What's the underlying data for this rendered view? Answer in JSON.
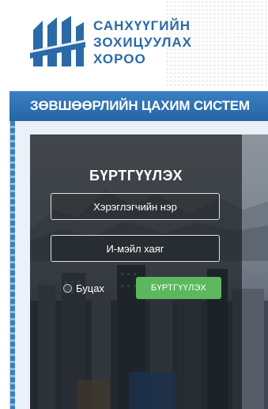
{
  "header": {
    "org_line1": "САНХҮҮГИЙН",
    "org_line2": "ЗОХИЦУУЛАХ",
    "org_line3": "ХОРОО"
  },
  "titlebar": {
    "title": "ЗӨВШӨӨРЛИЙН ЦАХИМ СИСТЕМ"
  },
  "form": {
    "title": "БҮРТГҮҮЛЭХ",
    "username_placeholder": "Хэрэглэгчийн нэр",
    "email_placeholder": "И-мэйл хаяг",
    "back_label": "Буцах",
    "submit_label": "БҮРТГҮҮЛЭХ"
  },
  "colors": {
    "brand_blue": "#2a6aa8",
    "titlebar_blue": "#3a7fc2",
    "submit_green": "#5cb85c"
  }
}
